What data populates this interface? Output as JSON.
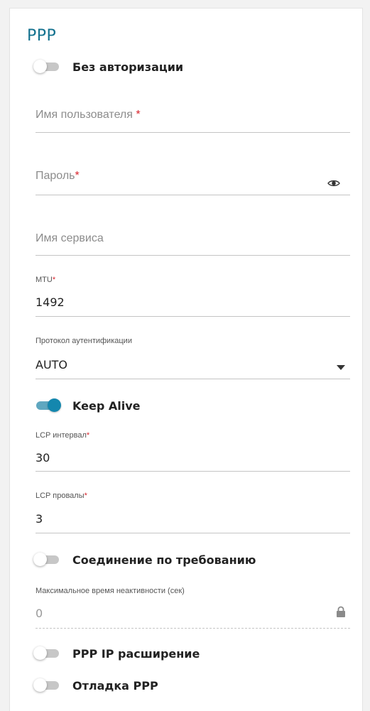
{
  "section_title": "PPP",
  "no_auth": {
    "label": "Без авторизации",
    "on": false
  },
  "username": {
    "placeholder": "Имя пользователя",
    "required_mark": "*"
  },
  "password": {
    "placeholder": "Пароль",
    "required_mark": "*",
    "icon": "eye-icon"
  },
  "service_name": {
    "placeholder": "Имя сервиса"
  },
  "mtu": {
    "label": "MTU",
    "required_mark": "*",
    "value": "1492"
  },
  "auth_protocol": {
    "label": "Протокол аутентификации",
    "value": "AUTO",
    "icon": "caret-down-icon"
  },
  "keep_alive": {
    "label": "Keep Alive",
    "on": true
  },
  "lcp_interval": {
    "label": "LCP интервал",
    "required_mark": "*",
    "value": "30"
  },
  "lcp_failures": {
    "label": "LCP провалы",
    "required_mark": "*",
    "value": "3"
  },
  "on_demand": {
    "label": "Соединение по требованию",
    "on": false
  },
  "max_idle": {
    "label": "Максимальное время неактивности (сек)",
    "value": "0",
    "icon": "lock-icon"
  },
  "ppp_ip_ext": {
    "label": "PPP IP расширение",
    "on": false
  },
  "ppp_debug": {
    "label": "Отладка PPP",
    "on": false
  },
  "colors": {
    "accent": "#1487ae",
    "title": "#14728f",
    "required": "#d9262e"
  }
}
